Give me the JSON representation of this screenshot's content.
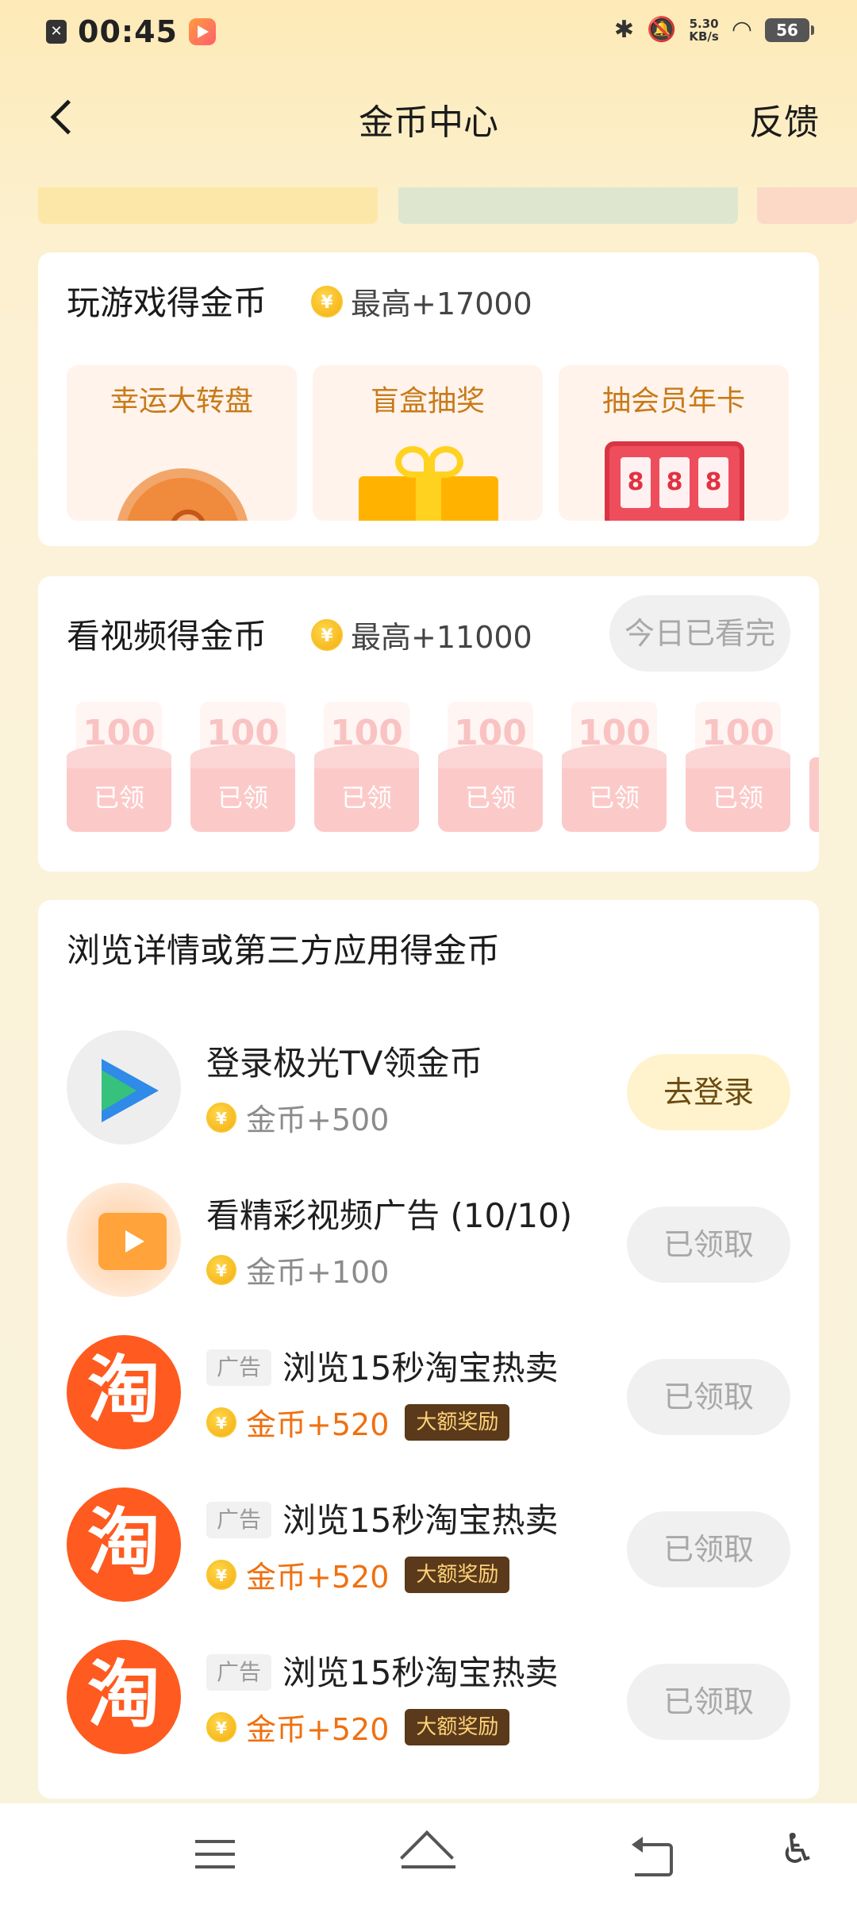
{
  "status_bar": {
    "time": "00:45",
    "net_speed_value": "5.30",
    "net_speed_unit": "KB/s",
    "battery": "56"
  },
  "header": {
    "title": "金币中心",
    "feedback": "反馈"
  },
  "games": {
    "title": "玩游戏得金币",
    "max_reward": "最高+17000",
    "items": [
      {
        "label": "幸运大转盘"
      },
      {
        "label": "盲盒抽奖"
      },
      {
        "label": "抽会员年卡"
      }
    ],
    "slot_digits": [
      "8",
      "8",
      "8"
    ]
  },
  "video": {
    "title": "看视频得金币",
    "max_reward": "最高+11000",
    "status_button": "今日已看完",
    "envelopes": [
      {
        "amount": "100",
        "label": "已领"
      },
      {
        "amount": "100",
        "label": "已领"
      },
      {
        "amount": "100",
        "label": "已领"
      },
      {
        "amount": "100",
        "label": "已领"
      },
      {
        "amount": "100",
        "label": "已领"
      },
      {
        "amount": "100",
        "label": "已领"
      }
    ]
  },
  "browse": {
    "title": "浏览详情或第三方应用得金币",
    "tasks": [
      {
        "title": "登录极光TV领金币",
        "reward": "金币+500",
        "button": "去登录"
      },
      {
        "title": "看精彩视频广告 (10/10)",
        "reward": "金币+100",
        "button": "已领取"
      },
      {
        "ad_tag": "广告",
        "title": "浏览15秒淘宝热卖",
        "reward": "金币+520",
        "badge": "大额奖励",
        "button": "已领取",
        "icon_text": "淘"
      },
      {
        "ad_tag": "广告",
        "title": "浏览15秒淘宝热卖",
        "reward": "金币+520",
        "badge": "大额奖励",
        "button": "已领取",
        "icon_text": "淘"
      },
      {
        "ad_tag": "广告",
        "title": "浏览15秒淘宝热卖",
        "reward": "金币+520",
        "badge": "大额奖励",
        "button": "已领取",
        "icon_text": "淘"
      }
    ]
  },
  "coin_symbol": "¥",
  "colors": {
    "page_bg": "#fcf0cf",
    "accent_orange": "#f0700f",
    "taobao_orange": "#ff5a1f"
  }
}
